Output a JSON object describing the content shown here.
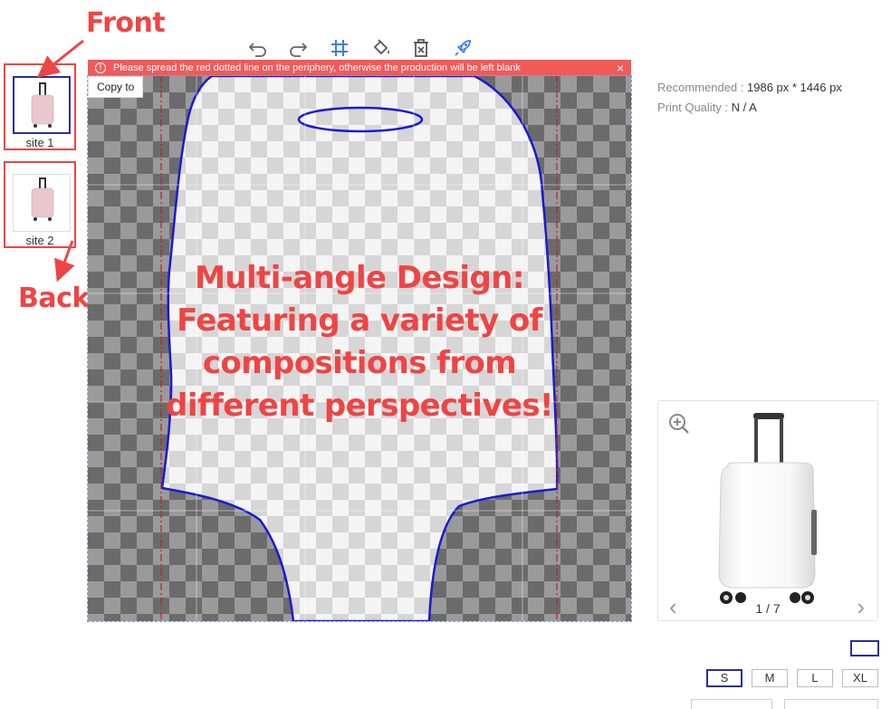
{
  "annotations": {
    "front_label": "Front",
    "back_label": "Back",
    "color": "#ef4444"
  },
  "sites": [
    {
      "caption": "site 1",
      "selected": true
    },
    {
      "caption": "site 2",
      "selected": false
    }
  ],
  "toolbar": {
    "icons": [
      "undo-icon",
      "redo-icon",
      "grid-icon",
      "fill-icon",
      "delete-icon",
      "rocket-icon"
    ],
    "accent": "#3b7cf0"
  },
  "warning": {
    "text": "Please spread the red dotted line on the periphery, otherwise the production will be left blank",
    "close": "×",
    "icon": "!"
  },
  "canvas": {
    "copy_to": "Copy to",
    "overlay_lines": [
      "Multi-angle Design:",
      "Featuring a variety of",
      "compositions from",
      "different perspectives!"
    ],
    "outline_color": "#1a1ad4",
    "guide_color": "#b3262e"
  },
  "info": {
    "recommended_label": "Recommended : ",
    "recommended_value": "1986 px * 1446 px",
    "quality_label": "Print Quality : ",
    "quality_value": "N / A"
  },
  "preview": {
    "counter": "1 / 7",
    "prev": "‹",
    "next": "›"
  },
  "sizes": [
    {
      "label": "S",
      "selected": true
    },
    {
      "label": "M",
      "selected": false
    },
    {
      "label": "L",
      "selected": false
    },
    {
      "label": "XL",
      "selected": false
    }
  ],
  "brand_color": "#2b2f8f"
}
